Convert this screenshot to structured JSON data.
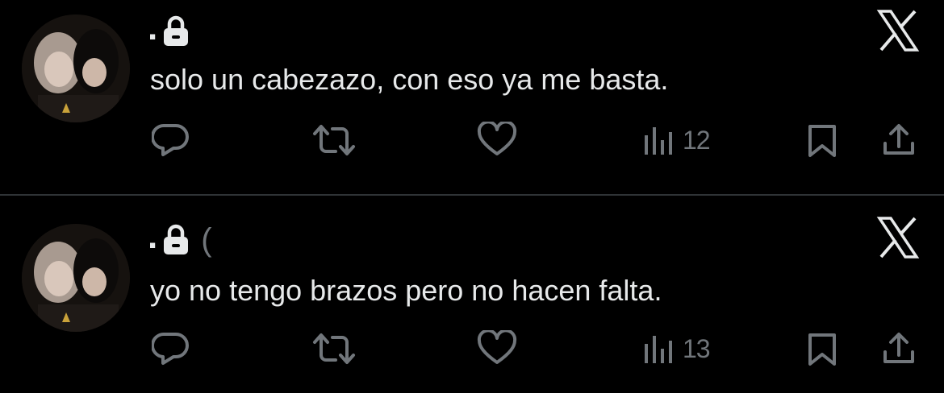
{
  "colors": {
    "background": "#000000",
    "text": "#e7e9ea",
    "muted": "#71767b",
    "divider": "#2f3336"
  },
  "tweets": [
    {
      "display_name": ".",
      "handle": "",
      "text": "solo un cabezazo, con eso ya me basta.",
      "views": "12",
      "icons": [
        "lock-icon",
        "x-logo-icon",
        "reply-icon",
        "retweet-icon",
        "like-icon",
        "views-icon",
        "bookmark-icon",
        "share-icon"
      ]
    },
    {
      "display_name": ".",
      "handle": "(",
      "text": "yo no tengo brazos pero no hacen falta.",
      "views": "13",
      "icons": [
        "lock-icon",
        "x-logo-icon",
        "reply-icon",
        "retweet-icon",
        "like-icon",
        "views-icon",
        "bookmark-icon",
        "share-icon"
      ]
    }
  ]
}
